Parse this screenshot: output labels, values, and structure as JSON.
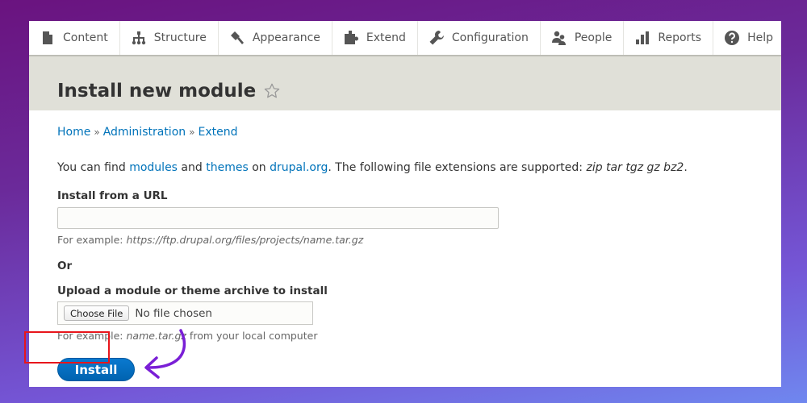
{
  "toolbar": {
    "items": [
      {
        "label": "Content",
        "icon": "content-icon"
      },
      {
        "label": "Structure",
        "icon": "structure-icon"
      },
      {
        "label": "Appearance",
        "icon": "appearance-icon"
      },
      {
        "label": "Extend",
        "icon": "extend-icon"
      },
      {
        "label": "Configuration",
        "icon": "configuration-icon"
      },
      {
        "label": "People",
        "icon": "people-icon"
      },
      {
        "label": "Reports",
        "icon": "reports-icon"
      },
      {
        "label": "Help",
        "icon": "help-icon"
      }
    ]
  },
  "header": {
    "title": "Install new module",
    "favorite_icon": "star-icon"
  },
  "breadcrumb": {
    "items": [
      "Home",
      "Administration",
      "Extend"
    ],
    "separator": "»"
  },
  "intro": {
    "text_1": "You can find ",
    "link_modules": "modules",
    "text_2": " and ",
    "link_themes": "themes",
    "text_3": " on ",
    "link_drupal": "drupal.org",
    "text_4": ". The following file extensions are supported: ",
    "extensions": "zip tar tgz gz bz2",
    "text_5": "."
  },
  "url_field": {
    "label": "Install from a URL",
    "value": "",
    "desc_prefix": "For example: ",
    "desc_example": "https://ftp.drupal.org/files/projects/name.tar.gz"
  },
  "or_label": "Or",
  "upload_field": {
    "label": "Upload a module or theme archive to install",
    "button_label": "Choose File",
    "status": "No file chosen",
    "desc_prefix": "For example: ",
    "desc_example": "name.tar.gz",
    "desc_suffix": " from your local computer"
  },
  "install_button": "Install",
  "annotation": {
    "highlight_color": "#e8151b",
    "arrow_color": "#7a1fd6"
  }
}
